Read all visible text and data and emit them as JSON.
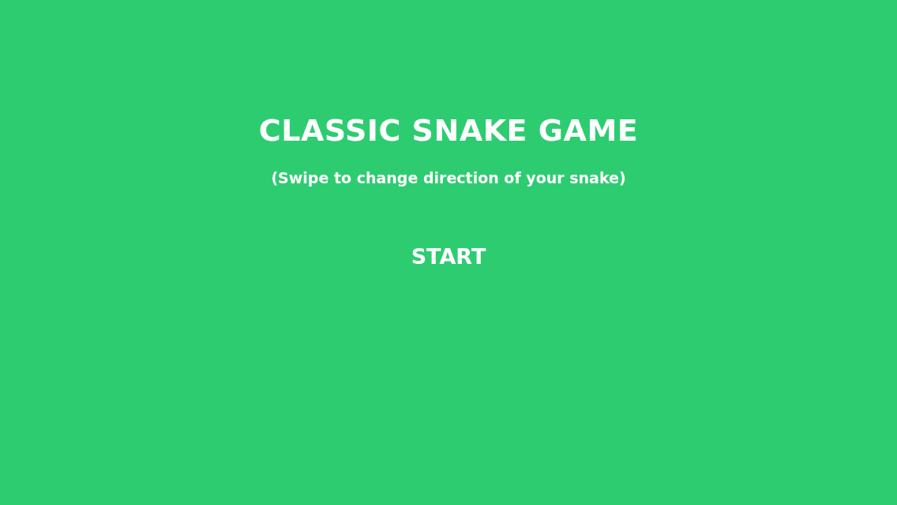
{
  "title": "CLASSIC SNAKE GAME",
  "subtitle": "(Swipe to change direction of your snake)",
  "start_button": {
    "label": "START"
  }
}
